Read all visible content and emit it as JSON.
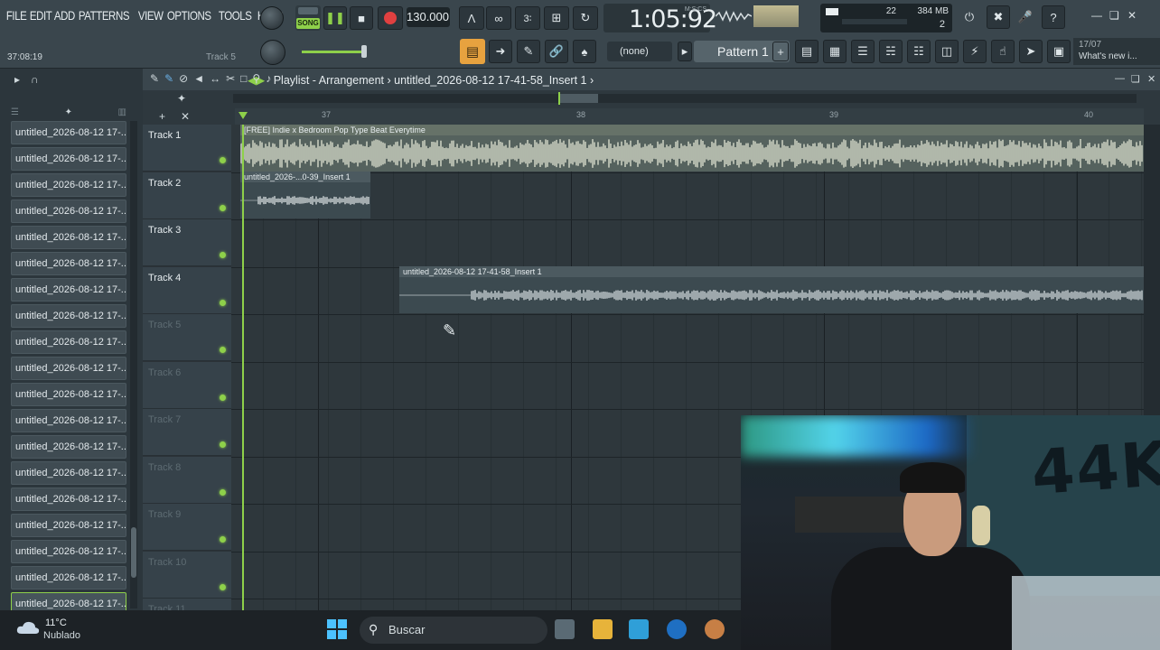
{
  "menu": [
    "FILE",
    "EDIT",
    "ADD",
    "PATTERNS",
    "VIEW",
    "OPTIONS",
    "TOOLS",
    "HELP"
  ],
  "hint": {
    "time": "37:08:19",
    "track": "Track 5"
  },
  "transport": {
    "mode": "SONG",
    "tempo": "130.000",
    "time": "1:05:92",
    "time_unit": "M:S:CS"
  },
  "resources": {
    "cpu": "22",
    "memory": "384 MB",
    "polyphony": "2"
  },
  "toolbar": {
    "channel_select": "(none)",
    "pattern": "Pattern 1",
    "news_date": "17/07",
    "news_text": "What's new i..."
  },
  "playlist": {
    "title": "Playlist - Arrangement",
    "breadcrumb": "untitled_2026-08-12 17-41-58_Insert 1",
    "bars": [
      "37",
      "38",
      "39",
      "40"
    ],
    "tracks": [
      "Track 1",
      "Track 2",
      "Track 3",
      "Track 4",
      "Track 5",
      "Track 6",
      "Track 7",
      "Track 8",
      "Track 9",
      "Track 10",
      "Track 11"
    ],
    "clips": [
      {
        "name": "[FREE] Indie x Bedroom Pop Type Beat Everytime"
      },
      {
        "name": "untitled_2026-...0-39_Insert 1"
      },
      {
        "name": "untitled_2026-08-12 17-41-58_Insert 1"
      }
    ]
  },
  "browser": {
    "items": [
      "untitled_2026-08-12 17-...",
      "untitled_2026-08-12 17-...",
      "untitled_2026-08-12 17-...",
      "untitled_2026-08-12 17-...",
      "untitled_2026-08-12 17-...",
      "untitled_2026-08-12 17-...",
      "untitled_2026-08-12 17-...",
      "untitled_2026-08-12 17-...",
      "untitled_2026-08-12 17-...",
      "untitled_2026-08-12 17-...",
      "untitled_2026-08-12 17-...",
      "untitled_2026-08-12 17-...",
      "untitled_2026-08-12 17-...",
      "untitled_2026-08-12 17-...",
      "untitled_2026-08-12 17-...",
      "untitled_2026-08-12 17-...",
      "untitled_2026-08-12 17-...",
      "untitled_2026-08-12 17-...",
      "untitled_2026-08-12 17-..."
    ]
  },
  "webcam": {
    "wall_text": "44K"
  },
  "taskbar": {
    "temperature": "11°C",
    "weather": "Nublado",
    "search_placeholder": "Buscar"
  },
  "colors": {
    "accent": "#8ed04a",
    "panel": "#3a464d",
    "grid": "#2e373c",
    "orange": "#e7a23f"
  }
}
